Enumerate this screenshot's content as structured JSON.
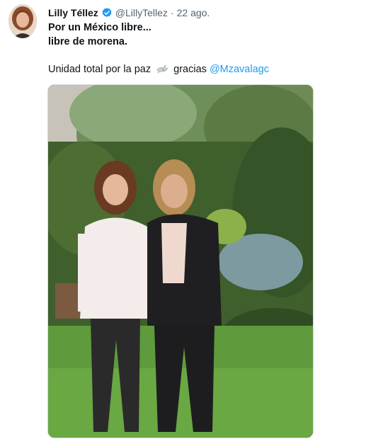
{
  "tweet": {
    "author_name": "Lilly Téllez",
    "handle": "@LillyTellez",
    "separator": "·",
    "date": "22 ago.",
    "line1": "Por un México libre...",
    "line2": "libre de morena.",
    "line3_prefix": "Unidad total por la paz",
    "line3_middle": "gracias",
    "mention": "@Mzavalagc"
  },
  "icons": {
    "verified": "verified-badge-icon",
    "dove": "dove-emoji-icon"
  },
  "colors": {
    "verified_blue": "#1d9bf0",
    "mention_blue": "#1d9bf0",
    "secondary_text": "#536471"
  }
}
